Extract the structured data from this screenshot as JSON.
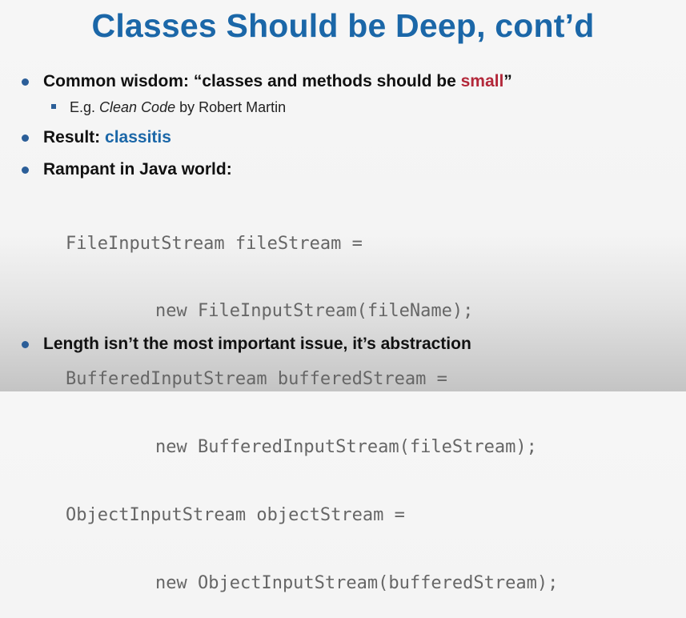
{
  "slide": {
    "title": "Classes Should be Deep, cont’d",
    "bullets": [
      {
        "prefix": "Common wisdom: “classes and methods should be ",
        "highlight": "small",
        "suffix": "”",
        "highlight_color": "#b3283a"
      },
      {
        "prefix": "Result: ",
        "highlight": "classitis",
        "highlight_color": "#1b67a8"
      },
      {
        "text": "Rampant in Java world:"
      },
      {
        "text": "Length isn’t the most important issue, it’s abstraction"
      }
    ],
    "sub_bullet": {
      "prefix": "E.g. ",
      "italic": "Clean Code",
      "suffix": " by Robert Martin"
    },
    "code_lines": [
      "FileInputStream fileStream =",
      "new FileInputStream(fileName);",
      "BufferedInputStream bufferedStream =",
      "new BufferedInputStream(fileStream);",
      "ObjectInputStream objectStream =",
      "new ObjectInputStream(bufferedStream);"
    ],
    "colors": {
      "title": "#1b67a8",
      "bullet_dot": "#2b5e98",
      "code_text": "#666666"
    }
  }
}
